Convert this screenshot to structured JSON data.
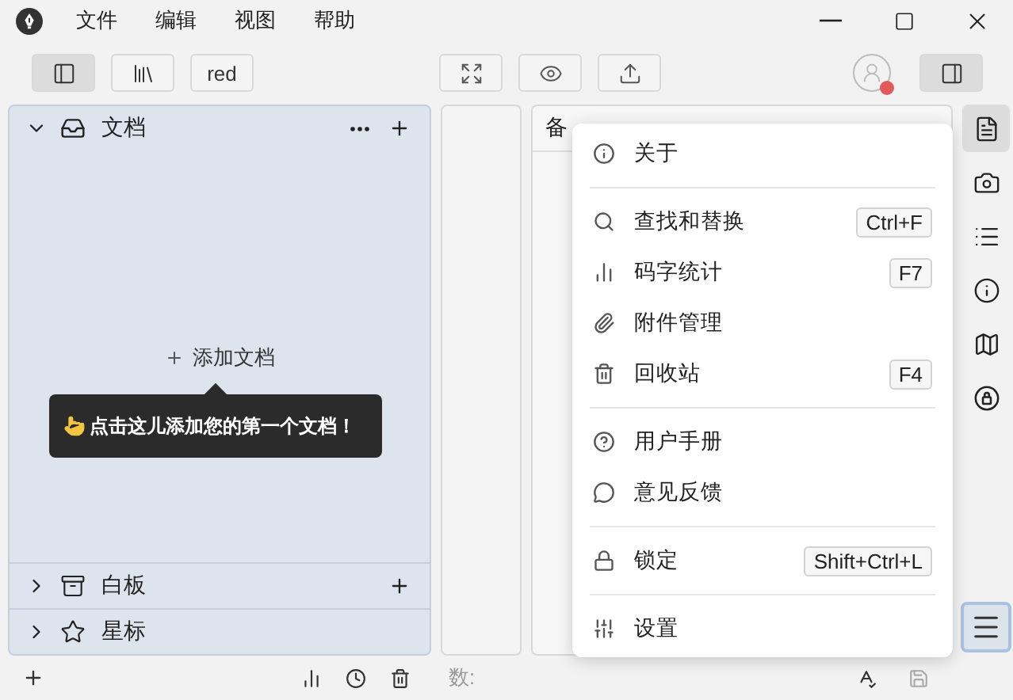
{
  "menubar": {
    "menus": [
      "文件",
      "编辑",
      "视图",
      "帮助"
    ]
  },
  "toolbar": {
    "left": [
      {
        "selected": true
      },
      {
        "selected": false
      },
      {
        "label": "red",
        "selected": false
      }
    ],
    "center": [
      {
        "selected": false
      },
      {
        "selected": false
      },
      {
        "selected": false
      }
    ],
    "panel_toggle": {
      "selected": true
    }
  },
  "sidebar": {
    "sections": [
      {
        "title": "文档",
        "expanded": true
      },
      {
        "title": "白板",
        "expanded": false
      },
      {
        "title": "星标",
        "expanded": false
      }
    ],
    "add_label": "添加文档",
    "tooltip": "点击这儿添加您的第一个文档！"
  },
  "editor": {
    "title": "备"
  },
  "menu": {
    "groups": [
      [
        {
          "label": "关于"
        }
      ],
      [
        {
          "label": "查找和替换",
          "shortcut": "Ctrl+F"
        },
        {
          "label": "码字统计",
          "shortcut": "F7"
        },
        {
          "label": "附件管理"
        },
        {
          "label": "回收站",
          "shortcut": "F4"
        }
      ],
      [
        {
          "label": "用户手册"
        },
        {
          "label": "意见反馈"
        }
      ],
      [
        {
          "label": "锁定",
          "shortcut": "Shift+Ctrl+L"
        }
      ],
      [
        {
          "label": "设置"
        }
      ]
    ]
  },
  "right_strip": {
    "tabs": [
      {
        "selected": true
      },
      {
        "selected": false
      },
      {
        "selected": false
      },
      {
        "selected": false
      },
      {
        "selected": false
      },
      {
        "selected": false
      }
    ],
    "menu_button": {
      "selected": true
    }
  },
  "status_bar": {
    "count_label": "数:"
  }
}
